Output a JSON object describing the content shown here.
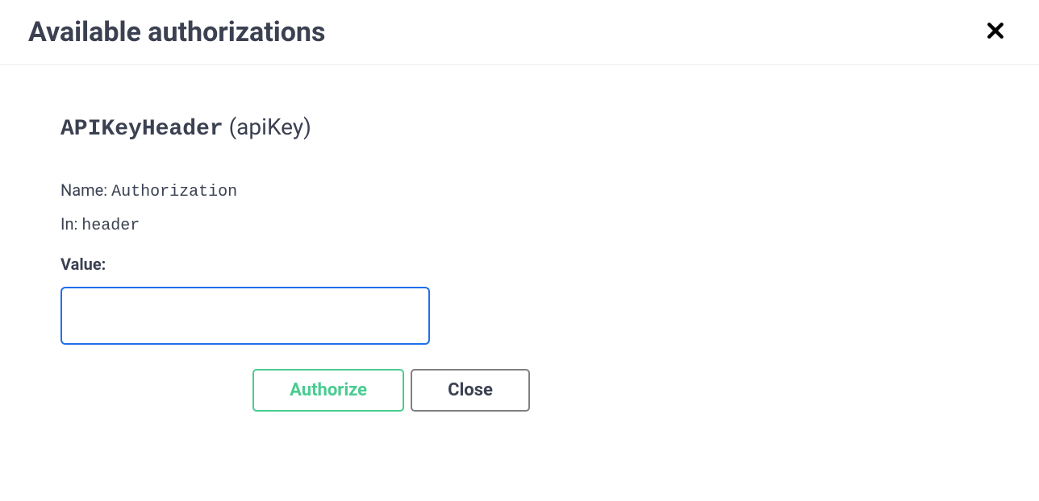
{
  "modal": {
    "title": "Available authorizations"
  },
  "auth": {
    "scheme_name": "APIKeyHeader",
    "scheme_type": "(apiKey)",
    "name_label": "Name:",
    "name_value": "Authorization",
    "in_label": "In:",
    "in_value": "header",
    "value_label": "Value:",
    "value_input": ""
  },
  "buttons": {
    "authorize": "Authorize",
    "close": "Close"
  }
}
